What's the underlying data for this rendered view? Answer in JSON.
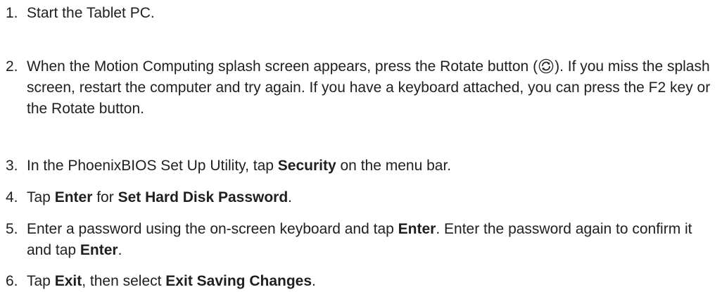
{
  "steps": [
    {
      "number": "1.",
      "parts": [
        {
          "text": "Start the Tablet PC.",
          "bold": false
        }
      ]
    },
    {
      "number": "2.",
      "parts": [
        {
          "text": "When the Motion Computing splash screen appears, press the Rotate button (",
          "bold": false
        },
        {
          "icon": "rotate-icon"
        },
        {
          "text": "). If you miss the splash screen, restart the computer and try again. If you have a keyboard attached, you can press the F2 key or the Rotate button.",
          "bold": false
        }
      ]
    },
    {
      "number": "3.",
      "parts": [
        {
          "text": "In the PhoenixBIOS Set Up Utility, tap ",
          "bold": false
        },
        {
          "text": "Security",
          "bold": true
        },
        {
          "text": " on the menu bar.",
          "bold": false
        }
      ]
    },
    {
      "number": "4.",
      "parts": [
        {
          "text": "Tap ",
          "bold": false
        },
        {
          "text": "Enter",
          "bold": true
        },
        {
          "text": " for ",
          "bold": false
        },
        {
          "text": "Set Hard Disk Password",
          "bold": true
        },
        {
          "text": ".",
          "bold": false
        }
      ]
    },
    {
      "number": "5.",
      "parts": [
        {
          "text": "Enter a password using the on-screen keyboard and tap ",
          "bold": false
        },
        {
          "text": "Enter",
          "bold": true
        },
        {
          "text": ". Enter the password again to confirm it and tap ",
          "bold": false
        },
        {
          "text": "Enter",
          "bold": true
        },
        {
          "text": ".",
          "bold": false
        }
      ]
    },
    {
      "number": "6.",
      "parts": [
        {
          "text": "Tap ",
          "bold": false
        },
        {
          "text": "Exit",
          "bold": true
        },
        {
          "text": ", then select ",
          "bold": false
        },
        {
          "text": "Exit Saving Changes",
          "bold": true
        },
        {
          "text": ".",
          "bold": false
        }
      ]
    }
  ],
  "colors": {
    "text": "#1f1f1f",
    "background": "#ffffff"
  }
}
